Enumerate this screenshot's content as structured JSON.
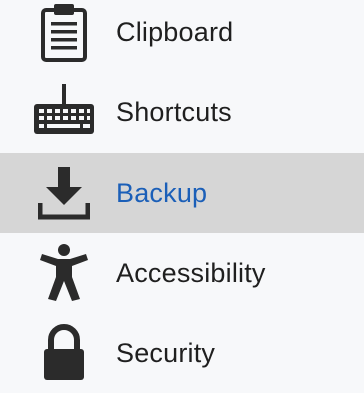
{
  "sidebar": {
    "items": [
      {
        "label": "Clipboard",
        "icon": "clipboard-icon",
        "active": false
      },
      {
        "label": "Shortcuts",
        "icon": "keyboard-icon",
        "active": false
      },
      {
        "label": "Backup",
        "icon": "download-icon",
        "active": true
      },
      {
        "label": "Accessibility",
        "icon": "accessibility-icon",
        "active": false
      },
      {
        "label": "Security",
        "icon": "lock-icon",
        "active": false
      }
    ]
  },
  "colors": {
    "background": "#f7f8fa",
    "active_background": "#d6d6d6",
    "active_text": "#1b5fb8",
    "text": "#1f1f1f",
    "icon": "#2b2b2b"
  }
}
